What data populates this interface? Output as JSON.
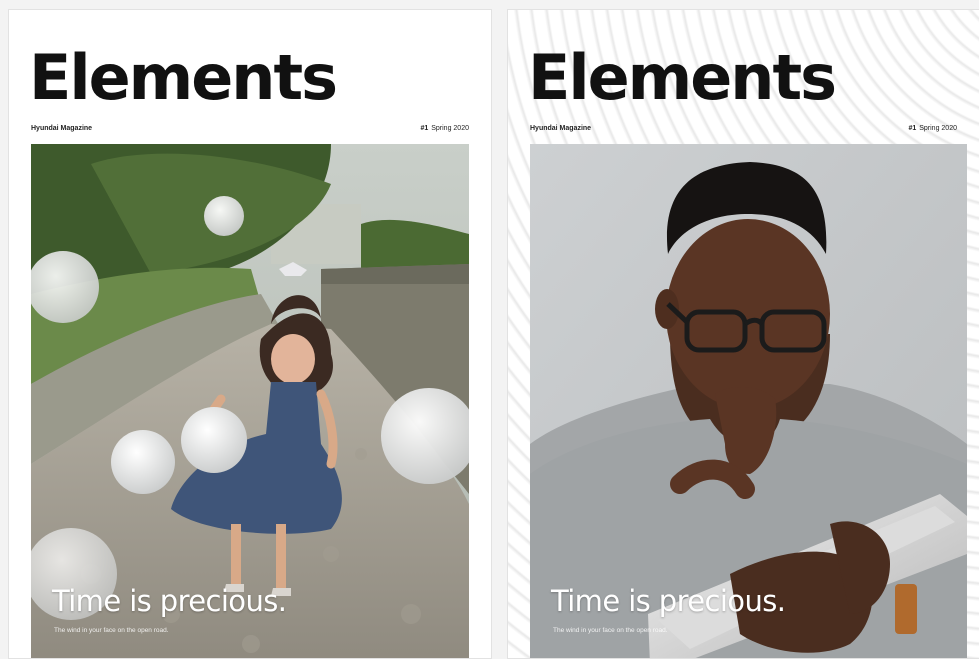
{
  "covers": [
    {
      "masthead": "Elements",
      "publication": "Hyundai Magazine",
      "issue_number": "#1",
      "issue_season": "Spring 2020",
      "headline": "Time is precious.",
      "subline": "The wind in your face on the open road."
    },
    {
      "masthead": "Elements",
      "publication": "Hyundai Magazine",
      "issue_number": "#1",
      "issue_season": "Spring 2020",
      "headline": "Time is precious.",
      "subline": "The wind in your face on the open road."
    }
  ]
}
